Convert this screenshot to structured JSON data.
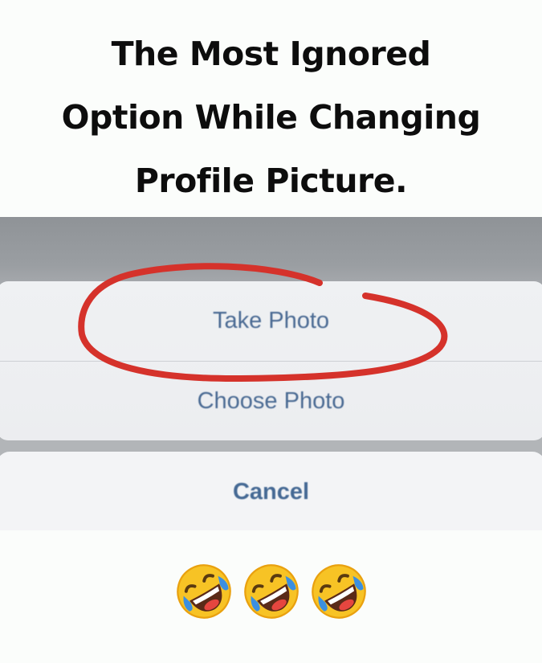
{
  "meme": {
    "title_lines": [
      "The Most Ignored",
      "Option While Changing",
      "Profile Picture."
    ]
  },
  "action_sheet": {
    "options": [
      "Take Photo",
      "Choose Photo"
    ],
    "cancel_label": "Cancel"
  },
  "annotation": {
    "circle_color": "#d5322b",
    "circled_option": "Take Photo"
  },
  "emojis": [
    "rolling-on-floor-laughing-icon",
    "rolling-on-floor-laughing-icon",
    "rolling-on-floor-laughing-icon"
  ],
  "colors": {
    "option_text": "#4a6a93",
    "background": "#fbfdfb"
  }
}
